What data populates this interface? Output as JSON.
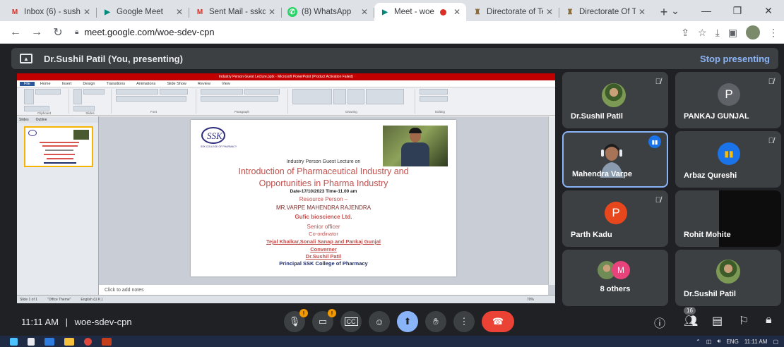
{
  "browser": {
    "tabs": [
      {
        "title": "Inbox (6) - sushi",
        "favicon": "gmail-icon",
        "color": "#d93025",
        "active": false
      },
      {
        "title": "Google Meet",
        "favicon": "meet-icon",
        "color": "#00897b",
        "active": false
      },
      {
        "title": "Sent Mail - sskd",
        "favicon": "gmail-icon",
        "color": "#d93025",
        "active": false
      },
      {
        "title": "(8) WhatsApp",
        "favicon": "whatsapp-icon",
        "color": "#25d366",
        "active": false
      },
      {
        "title": "Meet - woe",
        "favicon": "meet-icon",
        "color": "#00897b",
        "active": true
      },
      {
        "title": "Directorate of Te",
        "favicon": "emblem-icon",
        "color": "#8a6d3b",
        "active": false
      },
      {
        "title": "Directorate Of Te",
        "favicon": "emblem-icon",
        "color": "#8a6d3b",
        "active": false
      }
    ],
    "url": "meet.google.com/woe-sdev-cpn"
  },
  "presenting_bar": {
    "text": "Dr.Sushil Patil (You, presenting)",
    "stop_label": "Stop presenting"
  },
  "ppt": {
    "window_title": "Industry Person Guest Lecture.pptx - Microsoft PowerPoint (Product Activation Failed)",
    "tabs": [
      "File",
      "Home",
      "Insert",
      "Design",
      "Transitions",
      "Animations",
      "Slide Show",
      "Review",
      "View"
    ],
    "ribbon_groups": [
      "Clipboard",
      "Slides",
      "Font",
      "Paragraph",
      "Drawing",
      "Editing"
    ],
    "pane_tabs": [
      "Slides",
      "Outline"
    ],
    "notes_placeholder": "Click to add notes",
    "status": [
      "Slide 1 of 1",
      "\"Office Theme\"",
      "English (U.K.)",
      "70%"
    ],
    "slide": {
      "logo_text": "SSK",
      "logo_caption": "SSK COLLEGE OF PHARMACY",
      "guest_line": "Industry Person Guest Lecture on",
      "heading_line1": "Introduction of Pharmaceutical Industry and",
      "heading_line2": "Opportunities in Pharma Industry",
      "date": "Date-17/10/2023 Time-11.00 am",
      "resource_label": "Resource Person –",
      "resource_name": "MR.VARPE MAHENDRA RAJENDRA",
      "company": "Gufic bioscience Ltd.",
      "designation": "Senior officer",
      "coordinator_label": "Co-ordinator",
      "coordinators": "Tejal Khalkar,Sonali Sanap and Pankaj Gunjal",
      "convener_label": "Converner",
      "convener_name": "Dr.Sushil Patil",
      "principal": "Principal SSK College of Pharmacy"
    }
  },
  "participants": [
    {
      "name": "Dr.Sushil Patil",
      "type": "photo",
      "muted": true
    },
    {
      "name": "PANKAJ GUNJAL",
      "type": "letter",
      "letter": "P",
      "color": "#5f6368",
      "muted": true
    },
    {
      "name": "Mahendra Varpe",
      "type": "video",
      "speaking": true
    },
    {
      "name": "Arbaz Qureshi",
      "type": "icon",
      "muted": true
    },
    {
      "name": "Parth Kadu",
      "type": "letter",
      "letter": "P",
      "color": "#e8471e",
      "muted": true
    },
    {
      "name": "Rohit Mohite",
      "type": "dark",
      "muted": true
    },
    {
      "name": "8 others",
      "type": "group",
      "letter": "M"
    },
    {
      "name": "Dr.Sushil Patil",
      "type": "photo-small"
    }
  ],
  "controls": {
    "time": "11:11 AM",
    "separator": "|",
    "meeting_code": "woe-sdev-cpn",
    "people_count": "16",
    "accent": "#8ab4f8",
    "end_color": "#ea4335"
  },
  "taskbar": {
    "language": "ENG",
    "time": "11:11 AM"
  }
}
